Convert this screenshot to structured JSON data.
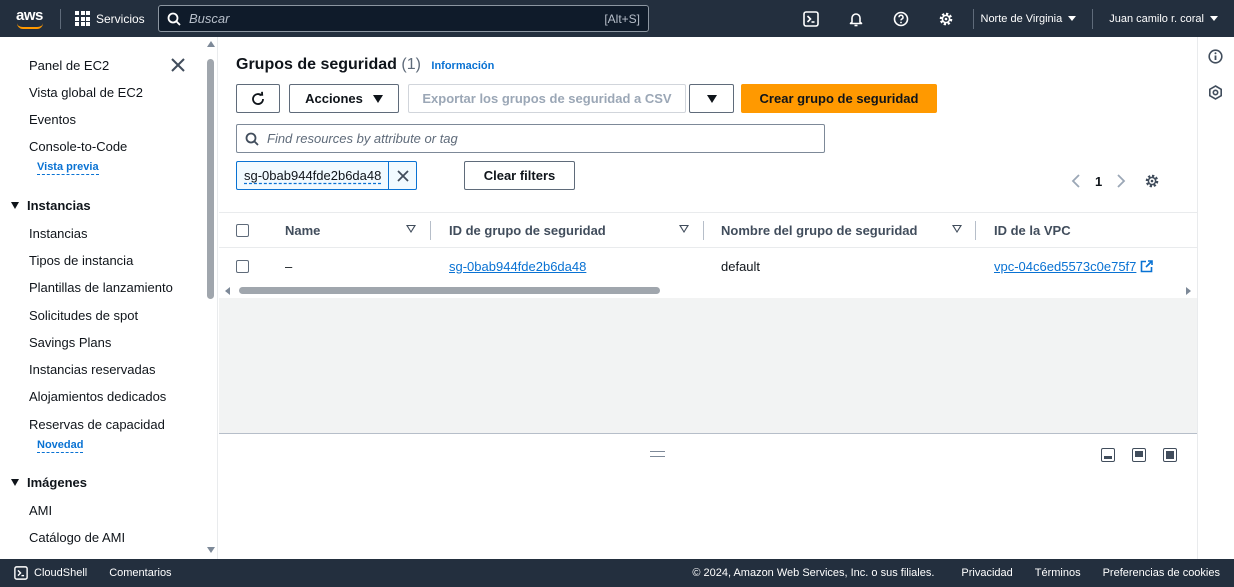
{
  "topbar": {
    "logo_text": "aws",
    "services_label": "Servicios",
    "search_placeholder": "Buscar",
    "search_shortcut": "[Alt+S]",
    "region": "Norte de Virginia",
    "user": "Juan camilo r. coral",
    "icons": [
      "cloudshell-icon",
      "bell-icon",
      "help-icon",
      "gear-icon"
    ]
  },
  "sidebar": {
    "items": [
      {
        "label": "Panel de EC2"
      },
      {
        "label": "Vista global de EC2"
      },
      {
        "label": "Eventos"
      },
      {
        "label": "Console-to-Code",
        "badge": "Vista previa"
      }
    ],
    "sections": [
      {
        "title": "Instancias",
        "items": [
          {
            "label": "Instancias"
          },
          {
            "label": "Tipos de instancia"
          },
          {
            "label": "Plantillas de lanzamiento"
          },
          {
            "label": "Solicitudes de spot"
          },
          {
            "label": "Savings Plans"
          },
          {
            "label": "Instancias reservadas"
          },
          {
            "label": "Alojamientos dedicados"
          },
          {
            "label": "Reservas de capacidad",
            "badge": "Novedad"
          }
        ]
      },
      {
        "title": "Imágenes",
        "items": [
          {
            "label": "AMI"
          },
          {
            "label": "Catálogo de AMI"
          }
        ]
      }
    ]
  },
  "main": {
    "title": "Grupos de seguridad",
    "count": "(1)",
    "info_link": "Información",
    "actions_label": "Acciones",
    "export_label": "Exportar los grupos de seguridad a CSV",
    "create_label": "Crear grupo de seguridad",
    "filter_placeholder": "Find resources by attribute or tag",
    "filter_token": "sg-0bab944fde2b6da48",
    "clear_filters": "Clear filters",
    "page_number": "1",
    "columns": [
      "Name",
      "ID de grupo de seguridad",
      "Nombre del grupo de seguridad",
      "ID de la VPC"
    ],
    "rows": [
      {
        "name": "–",
        "sg_id": "sg-0bab944fde2b6da48",
        "sg_name": "default",
        "vpc_id": "vpc-04c6ed5573c0e75f7"
      }
    ]
  },
  "footer": {
    "cloudshell": "CloudShell",
    "feedback": "Comentarios",
    "copyright": "© 2024, Amazon Web Services, Inc. o sus filiales.",
    "privacy": "Privacidad",
    "terms": "Términos",
    "cookies": "Preferencias de cookies"
  },
  "colors": {
    "topbar_bg": "#232f3e",
    "accent_orange": "#ff9900",
    "link_blue": "#0972d3"
  }
}
